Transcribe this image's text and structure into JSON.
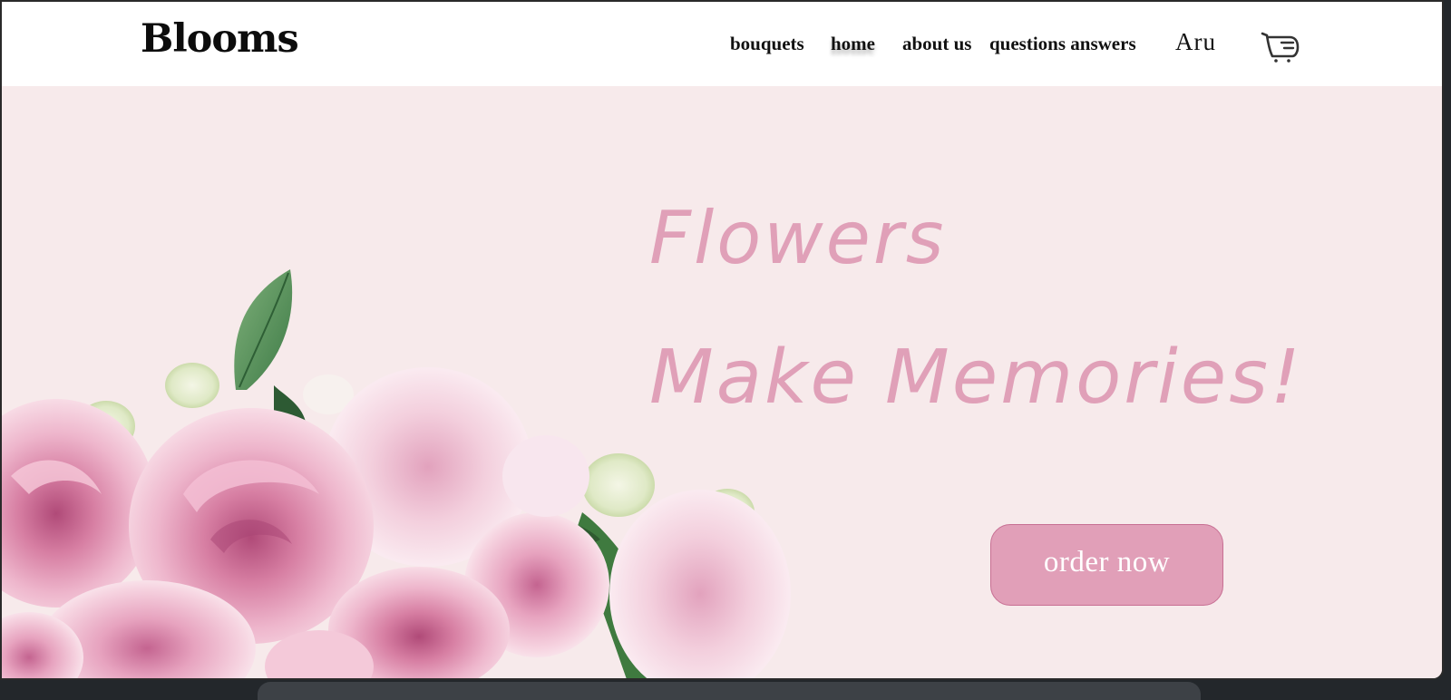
{
  "header": {
    "logo": "Blooms",
    "nav": [
      {
        "label": "bouquets"
      },
      {
        "label": "home"
      },
      {
        "label": "about us"
      },
      {
        "label": "questions answers"
      }
    ],
    "user": "Aru",
    "cart_icon": "cart-icon"
  },
  "hero": {
    "headline_1": "Flowers",
    "headline_2": "Make Memories!",
    "cta_label": "order now",
    "image": "pink-roses-bouquet"
  },
  "colors": {
    "hero_background": "#f7eaeb",
    "accent_pink": "#e0a0b8",
    "button_pink": "#e19fb8",
    "text_dark": "#111111"
  }
}
